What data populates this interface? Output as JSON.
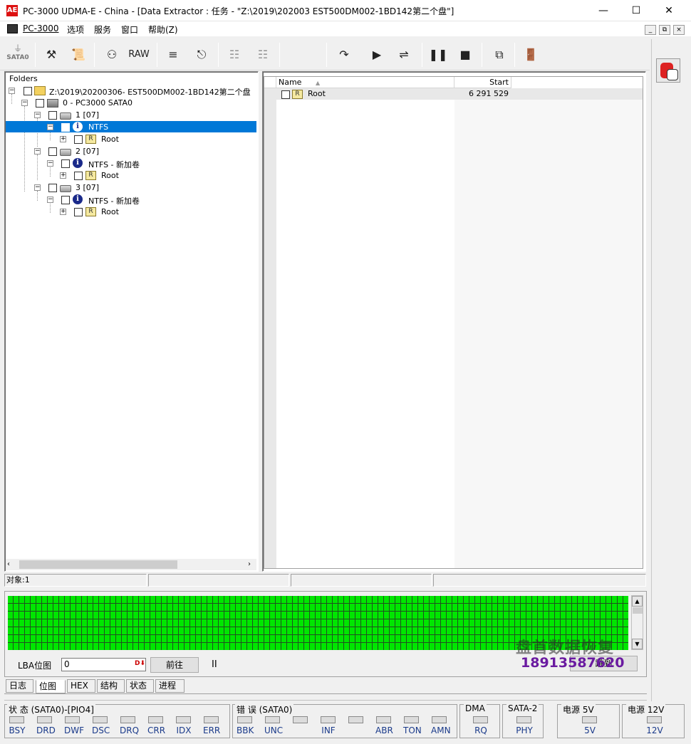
{
  "window": {
    "title": "PC-3000 UDMA-E - China - [Data Extractor : 任务 - \"Z:\\2019\\202003 EST500DM002-1BD142第二个盘\"]",
    "app_icon": "AE",
    "controls": [
      "minimize-icon",
      "maximize-icon",
      "close-icon"
    ]
  },
  "menu": {
    "items": [
      "PC-3000",
      "选项",
      "服务",
      "窗口",
      "帮助(Z)"
    ]
  },
  "toolbar": {
    "sata_label": "SATA0",
    "raw_label": "RAW"
  },
  "folders": {
    "header": "Folders",
    "root_path": "Z:\\2019\\20200306-    EST500DM002-1BD142第二个盘",
    "device": "0 - PC3000 SATA0",
    "nodes": [
      {
        "partition": "1 [07]",
        "fs": "NTFS",
        "child": "Root"
      },
      {
        "partition": "2 [07]",
        "fs": "NTFS - 新加卷",
        "child": "Root"
      },
      {
        "partition": "3 [07]",
        "fs": "NTFS - 新加卷",
        "child": "Root"
      }
    ]
  },
  "list": {
    "columns": [
      "Name",
      "Start"
    ],
    "rows": [
      {
        "name": "Root",
        "start": "6 291 529"
      }
    ]
  },
  "status": {
    "objects": "对象:1"
  },
  "map": {
    "lba_label": "LBA位图",
    "lba_value": "0",
    "lba_spin": "D⬇",
    "prev_button": "前往",
    "pause_glyph": "II",
    "right_button": "跳到",
    "watermark_line1": "盘首数据恢复",
    "watermark_line2": "18913587620"
  },
  "tabs": [
    "日志",
    "位图",
    "HEX",
    "结构",
    "状态",
    "进程"
  ],
  "active_tab": "位图",
  "indicators": {
    "state_title": "状 态 (SATA0)-[PIO4]",
    "state_leds": [
      "BSY",
      "DRD",
      "DWF",
      "DSC",
      "DRQ",
      "CRR",
      "IDX",
      "ERR"
    ],
    "error_title": "错 误 (SATA0)",
    "error_leds": [
      "BBK",
      "UNC",
      "",
      "INF",
      "",
      "ABR",
      "TON",
      "AMN"
    ],
    "dma_title": "DMA",
    "dma_leds": [
      "RQ"
    ],
    "sata2_title": "SATA-2",
    "sata2_leds": [
      "PHY"
    ],
    "p5_title": "电源 5V",
    "p5_leds": [
      "5V"
    ],
    "p12_title": "电源 12V",
    "p12_leds": [
      "12V"
    ]
  }
}
